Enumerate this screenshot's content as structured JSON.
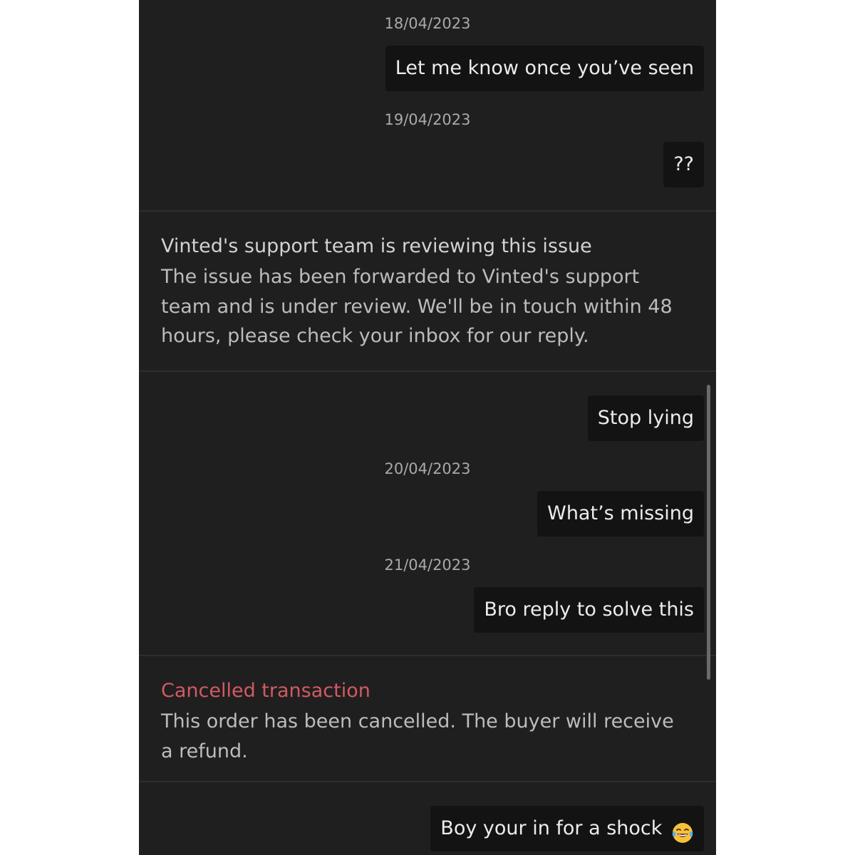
{
  "messages": [
    {
      "date": "18/04/2023",
      "text": "Let me know once you’ve seen"
    },
    {
      "date": "19/04/2023",
      "text": "??"
    },
    {
      "text": "Stop lying"
    },
    {
      "date": "20/04/2023",
      "text": "What’s missing"
    },
    {
      "date": "21/04/2023",
      "text": "Bro reply to solve this"
    },
    {
      "text": "Boy your in for a shock",
      "emoji": "face-with-tears-of-joy-emoji"
    }
  ],
  "support_notice": {
    "title": "Vinted's support team is reviewing this issue",
    "lines": [
      "The issue has been forwarded to Vinted's support",
      "team and is under review. We'll be in touch within 48",
      "hours, please check your inbox for our reply."
    ]
  },
  "cancel_notice": {
    "title": "Cancelled transaction",
    "title_color": "#d25a63",
    "lines": [
      "This order has been cancelled. The buyer will receive",
      "a refund."
    ]
  },
  "colors": {
    "background": "#1f1f1f",
    "bubble": "#131313",
    "text": "#ececec",
    "date": "#a9a9a9"
  }
}
